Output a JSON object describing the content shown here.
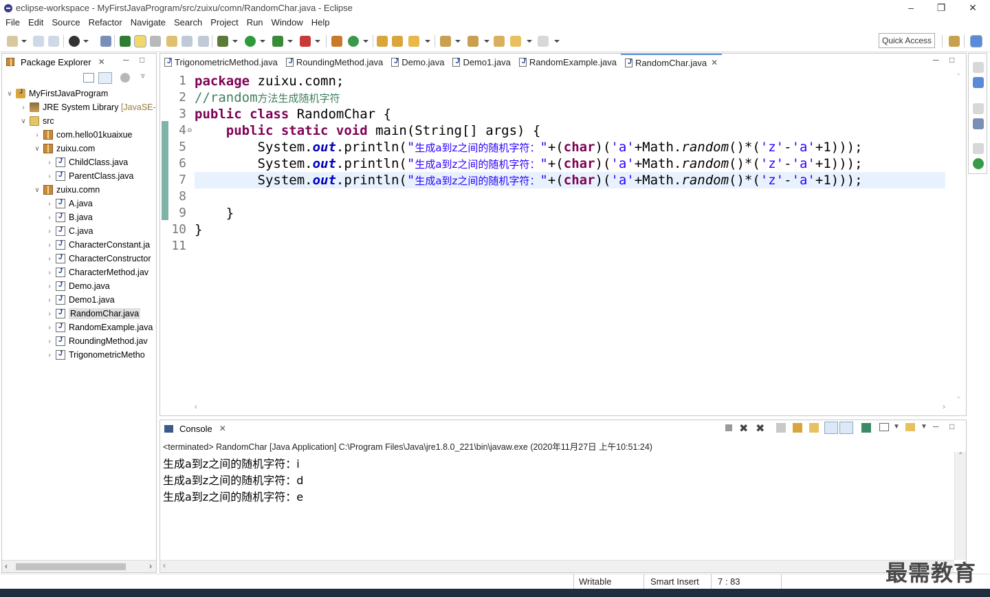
{
  "window": {
    "title": "eclipse-workspace - MyFirstJavaProgram/src/zuixu/comn/RandomChar.java - Eclipse"
  },
  "menu": [
    "File",
    "Edit",
    "Source",
    "Refactor",
    "Navigate",
    "Search",
    "Project",
    "Run",
    "Window",
    "Help"
  ],
  "toolbar": {
    "quick_access": "Quick Access"
  },
  "package_explorer": {
    "title": "Package Explorer",
    "tree": [
      {
        "label": "MyFirstJavaProgram",
        "icon": "project-icon",
        "expanded": true
      },
      {
        "label": "JRE System Library",
        "suffix": "[JavaSE-",
        "icon": "library-icon",
        "expanded": false
      },
      {
        "label": "src",
        "icon": "source-folder-icon",
        "expanded": true
      },
      {
        "label": "com.hello01kuaixue",
        "icon": "package-icon",
        "expanded": false
      },
      {
        "label": "zuixu.com",
        "icon": "package-icon",
        "expanded": true
      },
      {
        "label": "ChildClass.java",
        "icon": "java-file-icon"
      },
      {
        "label": "ParentClass.java",
        "icon": "java-file-icon"
      },
      {
        "label": "zuixu.comn",
        "icon": "package-icon",
        "expanded": true
      },
      {
        "label": "A.java",
        "icon": "java-file-icon"
      },
      {
        "label": "B.java",
        "icon": "java-file-icon"
      },
      {
        "label": "C.java",
        "icon": "java-file-icon"
      },
      {
        "label": "CharacterConstant.ja",
        "icon": "java-file-icon"
      },
      {
        "label": "CharacterConstructor",
        "icon": "java-file-icon"
      },
      {
        "label": "CharacterMethod.jav",
        "icon": "java-file-icon"
      },
      {
        "label": "Demo.java",
        "icon": "java-file-icon"
      },
      {
        "label": "Demo1.java",
        "icon": "java-file-icon"
      },
      {
        "label": "RandomChar.java",
        "icon": "java-file-icon",
        "selected": true
      },
      {
        "label": "RandomExample.java",
        "icon": "java-file-icon"
      },
      {
        "label": "RoundingMethod.jav",
        "icon": "java-file-icon"
      },
      {
        "label": "TrigonometricMetho",
        "icon": "java-file-icon"
      }
    ]
  },
  "editor": {
    "tabs": [
      "TrigonometricMethod.java",
      "RoundingMethod.java",
      "Demo.java",
      "Demo1.java",
      "RandomExample.java",
      "RandomChar.java"
    ],
    "active_tab": "RandomChar.java",
    "line_numbers": [
      "1",
      "2",
      "3",
      "4",
      "5",
      "6",
      "7",
      "8",
      "9",
      "10",
      "11"
    ],
    "code": {
      "l1_kw": "package",
      "l1_rest": " zuixu.comn;",
      "l2_comment": "//random",
      "l2_comment_zh": "方法生成随机字符",
      "l3_kw1": "public",
      "l3_kw2": "class",
      "l3_rest": " RandomChar {",
      "l4_indent": "    ",
      "l4_kw": "public static void",
      "l4_rest1": " main(String[] ",
      "l4_args": "args",
      "l4_rest2": ") {",
      "print_prefix": "        System.",
      "print_field": "out",
      "print_call": ".println(",
      "print_str_q": "\"",
      "print_str_zh": "生成a到z之间的随机字符：",
      "print_mid": "+(",
      "print_kw_char": "char",
      "print_cast_close": ")(",
      "print_a": "'a'",
      "print_math": "+Math.",
      "print_random": "random",
      "print_times": "()*(",
      "print_z": "'z'",
      "print_minus": "-",
      "print_end": "+1)));",
      "l9": "    }",
      "l10": "}"
    },
    "current_line": "7"
  },
  "console": {
    "title": "Console",
    "process": "<terminated> RandomChar [Java Application] C:\\Program Files\\Java\\jre1.8.0_221\\bin\\javaw.exe (2020年11月27日 上午10:51:24)",
    "output": [
      "生成a到z之间的随机字符：i",
      "生成a到z之间的随机字符：d",
      "生成a到z之间的随机字符：e"
    ]
  },
  "status_bar": {
    "mode": "Writable",
    "insert": "Smart Insert",
    "position": "7 : 83"
  },
  "watermark": "最需教育",
  "colors": {
    "keyword": "#7f0055",
    "comment": "#3f7f5f",
    "string": "#2a00ff",
    "field": "#0000c0",
    "current_line": "#e8f2fe",
    "change_bar": "#7fb3a8"
  }
}
